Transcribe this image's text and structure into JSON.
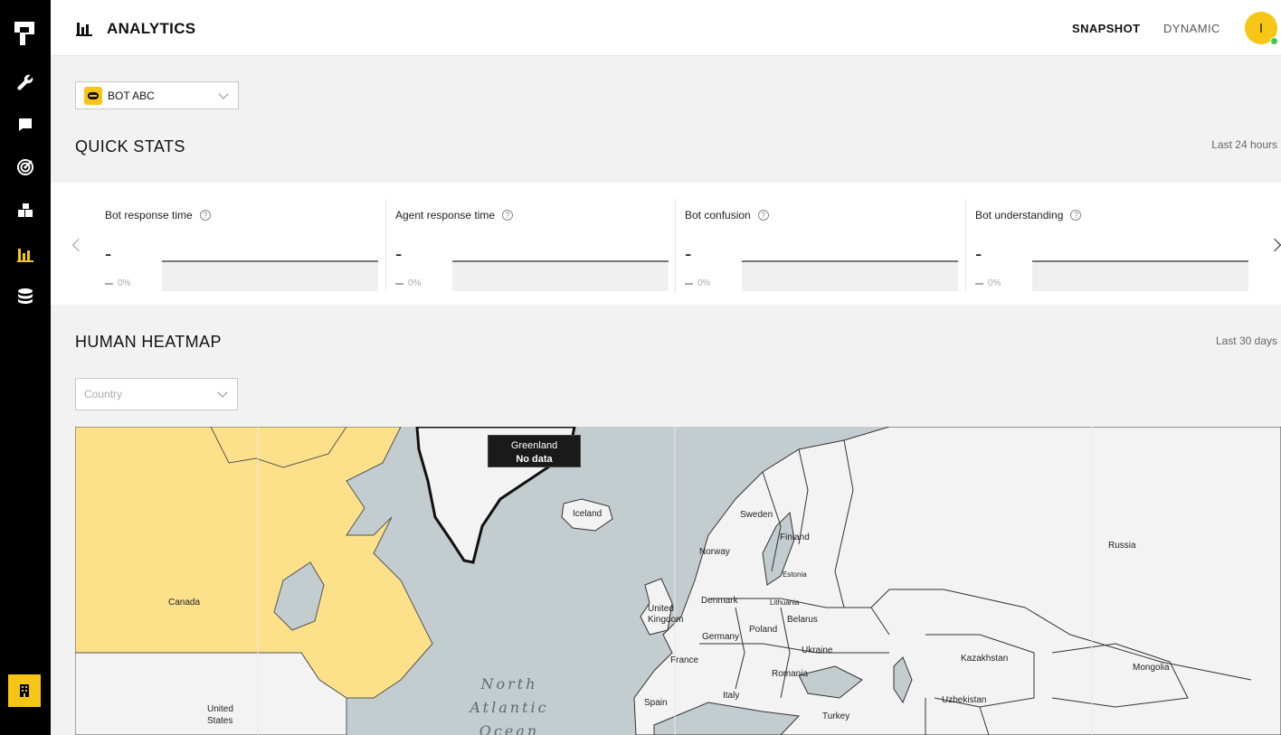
{
  "nav": {
    "items": [
      {
        "name": "tools",
        "icon": "wrench-icon"
      },
      {
        "name": "conversations",
        "icon": "chat-icon"
      },
      {
        "name": "goals",
        "icon": "target-icon"
      },
      {
        "name": "integrations",
        "icon": "blocks-icon"
      },
      {
        "name": "analytics",
        "icon": "bar-chart-icon",
        "active": true
      },
      {
        "name": "data",
        "icon": "database-icon"
      }
    ],
    "accent_color": "#f7c515"
  },
  "header": {
    "title": "ANALYTICS",
    "tabs": [
      {
        "label": "SNAPSHOT",
        "active": true
      },
      {
        "label": "DYNAMIC",
        "active": false
      }
    ],
    "avatar_initial": "I",
    "status_color": "#3ccf4e"
  },
  "bot_selector": {
    "selected": "BOT ABC"
  },
  "quick_stats": {
    "title": "QUICK STATS",
    "period": "Last 24 hours",
    "cards": [
      {
        "label": "Bot response time",
        "value": "-",
        "change": "0%"
      },
      {
        "label": "Agent response time",
        "value": "-",
        "change": "0%"
      },
      {
        "label": "Bot confusion",
        "value": "-",
        "change": "0%"
      },
      {
        "label": "Bot understanding",
        "value": "-",
        "change": "0%"
      }
    ]
  },
  "heatmap": {
    "title": "HUMAN HEATMAP",
    "period": "Last 30 days",
    "country_select": {
      "placeholder": "Country"
    },
    "tooltip": {
      "country": "Greenland",
      "value": "No data"
    },
    "highlight_color": "#fde08a",
    "labels": {
      "canada": "Canada",
      "united_states": "United States",
      "iceland": "Iceland",
      "sweden": "Sweden",
      "finland": "Finland",
      "norway": "Norway",
      "russia": "Russia",
      "estonia": "Estonia",
      "denmark": "Denmark",
      "lithuania": "Lithuania",
      "united_kingdom": "United Kingdom",
      "belarus": "Belarus",
      "poland": "Poland",
      "germany": "Germany",
      "ukraine": "Ukraine",
      "kazakhstan": "Kazakhstan",
      "mongolia": "Mongolia",
      "france": "France",
      "romania": "Romania",
      "spain": "Spain",
      "italy": "Italy",
      "turkey": "Turkey",
      "uzbekistan": "Uzbekistan",
      "north_atlantic_ocean": "North Atlantic Ocean"
    }
  }
}
